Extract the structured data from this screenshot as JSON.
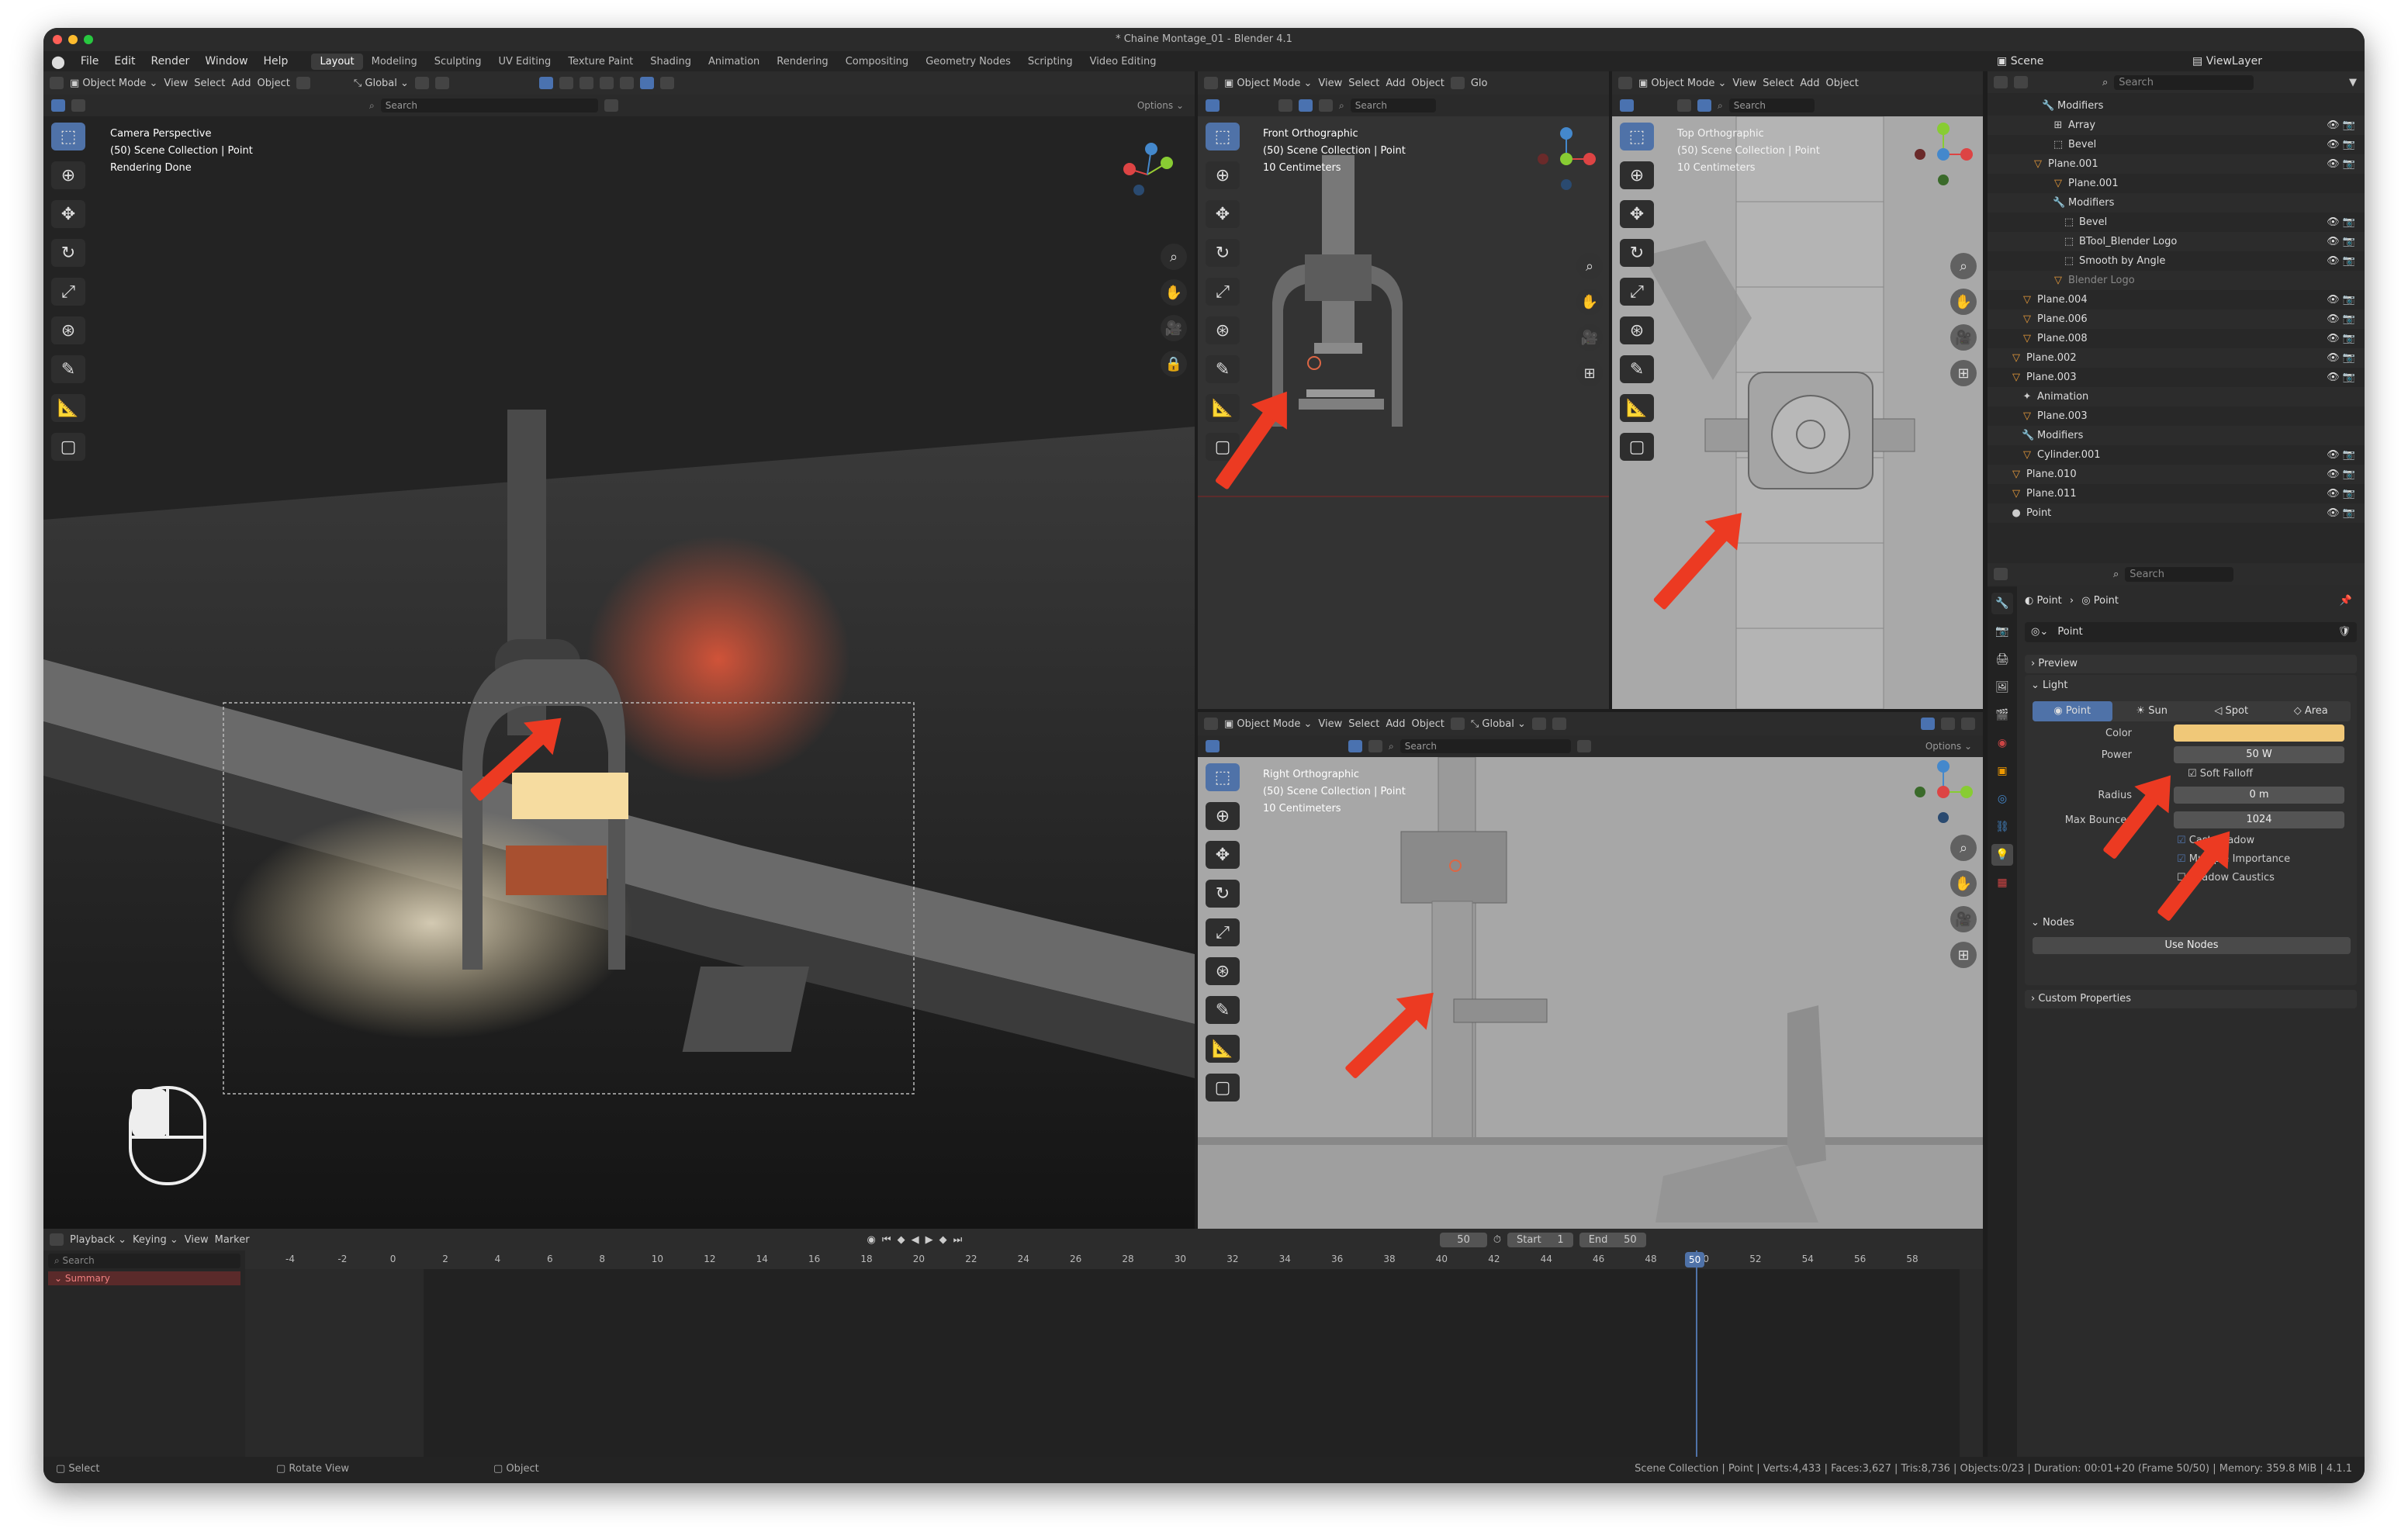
{
  "window": {
    "title": "* Chaine Montage_01 - Blender 4.1"
  },
  "menus": [
    "File",
    "Edit",
    "Render",
    "Window",
    "Help"
  ],
  "workspaces": [
    "Layout",
    "Modeling",
    "Sculpting",
    "UV Editing",
    "Texture Paint",
    "Shading",
    "Animation",
    "Rendering",
    "Compositing",
    "Geometry Nodes",
    "Scripting",
    "Video Editing"
  ],
  "active_workspace": "Layout",
  "header": {
    "mode": "Object Mode",
    "view": "View",
    "select": "Select",
    "add": "Add",
    "object": "Object",
    "orientation": "Global",
    "options": "Options",
    "search": "Search",
    "orientation_cut": "Glo"
  },
  "viewport_main": {
    "line1": "Camera Perspective",
    "line2": "(50) Scene Collection | Point",
    "line3": "Rendering Done"
  },
  "viewport_front": {
    "line1": "Front Orthographic",
    "line2": "(50) Scene Collection | Point",
    "line3": "10 Centimeters"
  },
  "viewport_top": {
    "line1": "Top Orthographic",
    "line2": "(50) Scene Collection | Point",
    "line3": "10 Centimeters"
  },
  "viewport_right": {
    "line1": "Right Orthographic",
    "line2": "(50) Scene Collection | Point",
    "line3": "10 Centimeters"
  },
  "outliner": {
    "scene": "Scene",
    "viewlayer": "ViewLayer",
    "search": "Search",
    "items": [
      "Modifiers",
      "Array",
      "Bevel",
      "Plane.001",
      "Plane.001",
      "Modifiers",
      "Bevel",
      "BTool_Blender Logo",
      "Smooth by Angle",
      "Blender Logo",
      "Plane.004",
      "Plane.006",
      "Plane.008",
      "Plane.002",
      "Plane.003",
      "Animation",
      "Plane.003",
      "Modifiers",
      "Cylinder.001",
      "Plane.010",
      "Plane.011",
      "Point"
    ]
  },
  "properties": {
    "search": "Search",
    "breadcrumb_obj": "Point",
    "breadcrumb_data": "Point",
    "datablock": "Point",
    "preview": "Preview",
    "light": "Light",
    "types": [
      "Point",
      "Sun",
      "Spot",
      "Area"
    ],
    "active_type": "Point",
    "color_label": "Color",
    "color_value": "#f0c878",
    "power_label": "Power",
    "power_value": "50 W",
    "softfalloff_label": "Soft Falloff",
    "radius_label": "Radius",
    "radius_value": "0 m",
    "maxbounces_label": "Max Bounces",
    "maxbounces_value": "1024",
    "cast_shadow": "Cast Shadow",
    "multi_importance": "Multiple Importance",
    "shadow_caustics": "Shadow Caustics",
    "nodes": "Nodes",
    "use_nodes": "Use Nodes",
    "custom_props": "Custom Properties"
  },
  "timeline": {
    "playback": "Playback",
    "keying": "Keying",
    "view": "View",
    "marker": "Marker",
    "current_frame": "50",
    "start_label": "Start",
    "start": "1",
    "end_label": "End",
    "end": "50",
    "search": "Search",
    "summary": "Summary",
    "ticks": [
      "-4",
      "-2",
      "0",
      "2",
      "4",
      "6",
      "8",
      "10",
      "12",
      "14",
      "16",
      "18",
      "20",
      "22",
      "24",
      "26",
      "28",
      "30",
      "32",
      "34",
      "36",
      "38",
      "40",
      "42",
      "44",
      "46",
      "48",
      "50",
      "52",
      "54",
      "56",
      "58"
    ]
  },
  "status": {
    "left1": "Select",
    "left2": "Rotate View",
    "left3": "Object",
    "right": "Scene Collection | Point | Verts:4,433 | Faces:3,627 | Tris:8,736 | Objects:0/23 | Duration: 00:01+20 (Frame 50/50) | Memory: 359.8 MiB | 4.1.1"
  },
  "colors": {
    "accent": "#4f72a8",
    "arrow": "#ec3a22",
    "light_color": "#f0c878"
  }
}
